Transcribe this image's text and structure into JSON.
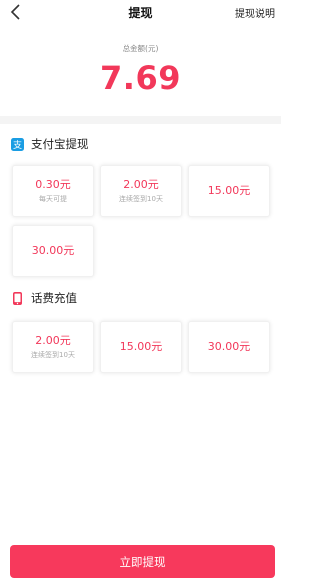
{
  "nav": {
    "title": "提现",
    "help": "提现说明"
  },
  "summary": {
    "label": "总金额(元)",
    "amount": "7.69"
  },
  "alipay": {
    "title": "支付宝提现",
    "options": [
      {
        "amount": "0.30元",
        "note": "每天可提"
      },
      {
        "amount": "2.00元",
        "note": "连续签到10天"
      },
      {
        "amount": "15.00元",
        "note": ""
      },
      {
        "amount": "30.00元",
        "note": ""
      }
    ]
  },
  "phone": {
    "title": "话费充值",
    "options": [
      {
        "amount": "2.00元",
        "note": "连续签到10天"
      },
      {
        "amount": "15.00元",
        "note": ""
      },
      {
        "amount": "30.00元",
        "note": ""
      }
    ]
  },
  "action": {
    "label": "立即提现"
  },
  "colors": {
    "accent": "#f2385a",
    "alipay_blue": "#1a9de3"
  },
  "icons": {
    "back": "chevron-left-icon",
    "alipay": "alipay-icon",
    "phone": "phone-icon"
  }
}
